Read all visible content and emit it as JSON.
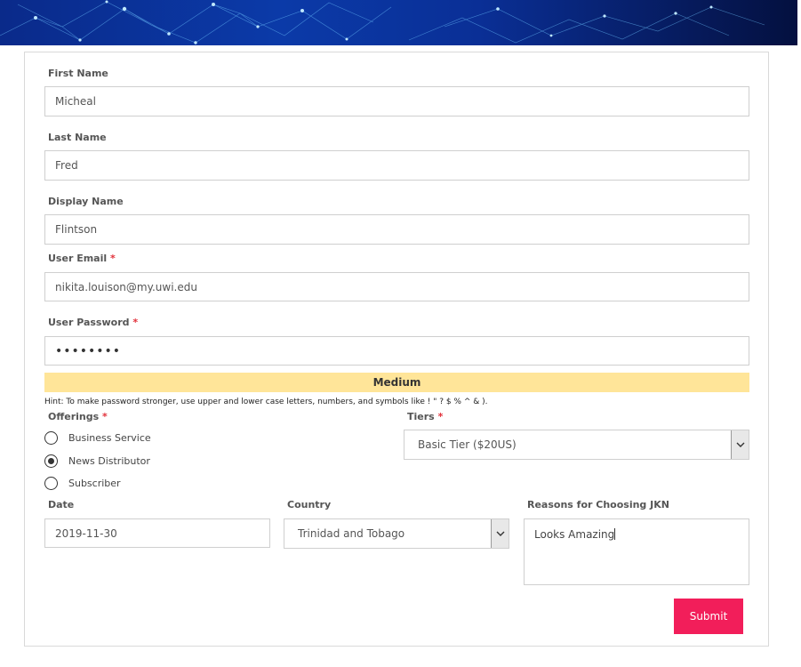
{
  "form": {
    "first_name": {
      "label": "First Name",
      "value": "Micheal"
    },
    "last_name": {
      "label": "Last Name",
      "value": "Fred"
    },
    "display_name": {
      "label": "Display Name",
      "value": "Flintson"
    },
    "user_email": {
      "label": "User Email",
      "required": "*",
      "value": "nikita.louison@my.uwi.edu"
    },
    "user_password": {
      "label": "User Password",
      "required": "*",
      "masked_value": "••••••••"
    },
    "password_strength": "Medium",
    "password_hint": "Hint: To make password stronger, use upper and lower case letters, numbers, and symbols like ! \" ? $ % ^ & ).",
    "offerings": {
      "label": "Offerings",
      "required": "*",
      "options": [
        "Business Service",
        "News Distributor",
        "Subscriber"
      ],
      "selected": "News Distributor"
    },
    "tiers": {
      "label": "Tiers",
      "required": "*",
      "value": "Basic Tier ($20US)"
    },
    "date": {
      "label": "Date",
      "value": "2019-11-30"
    },
    "country": {
      "label": "Country",
      "value": "Trinidad and Tobago"
    },
    "reasons": {
      "label": "Reasons for Choosing JKN",
      "value": "Looks Amazing"
    },
    "submit_label": "Submit"
  },
  "colors": {
    "strength_bar": "#ffe599",
    "submit": "#f21e5a",
    "required": "#e2303a",
    "banner": "#0b3aa8"
  },
  "icons": {
    "select_arrow": "chevron-down-icon"
  }
}
